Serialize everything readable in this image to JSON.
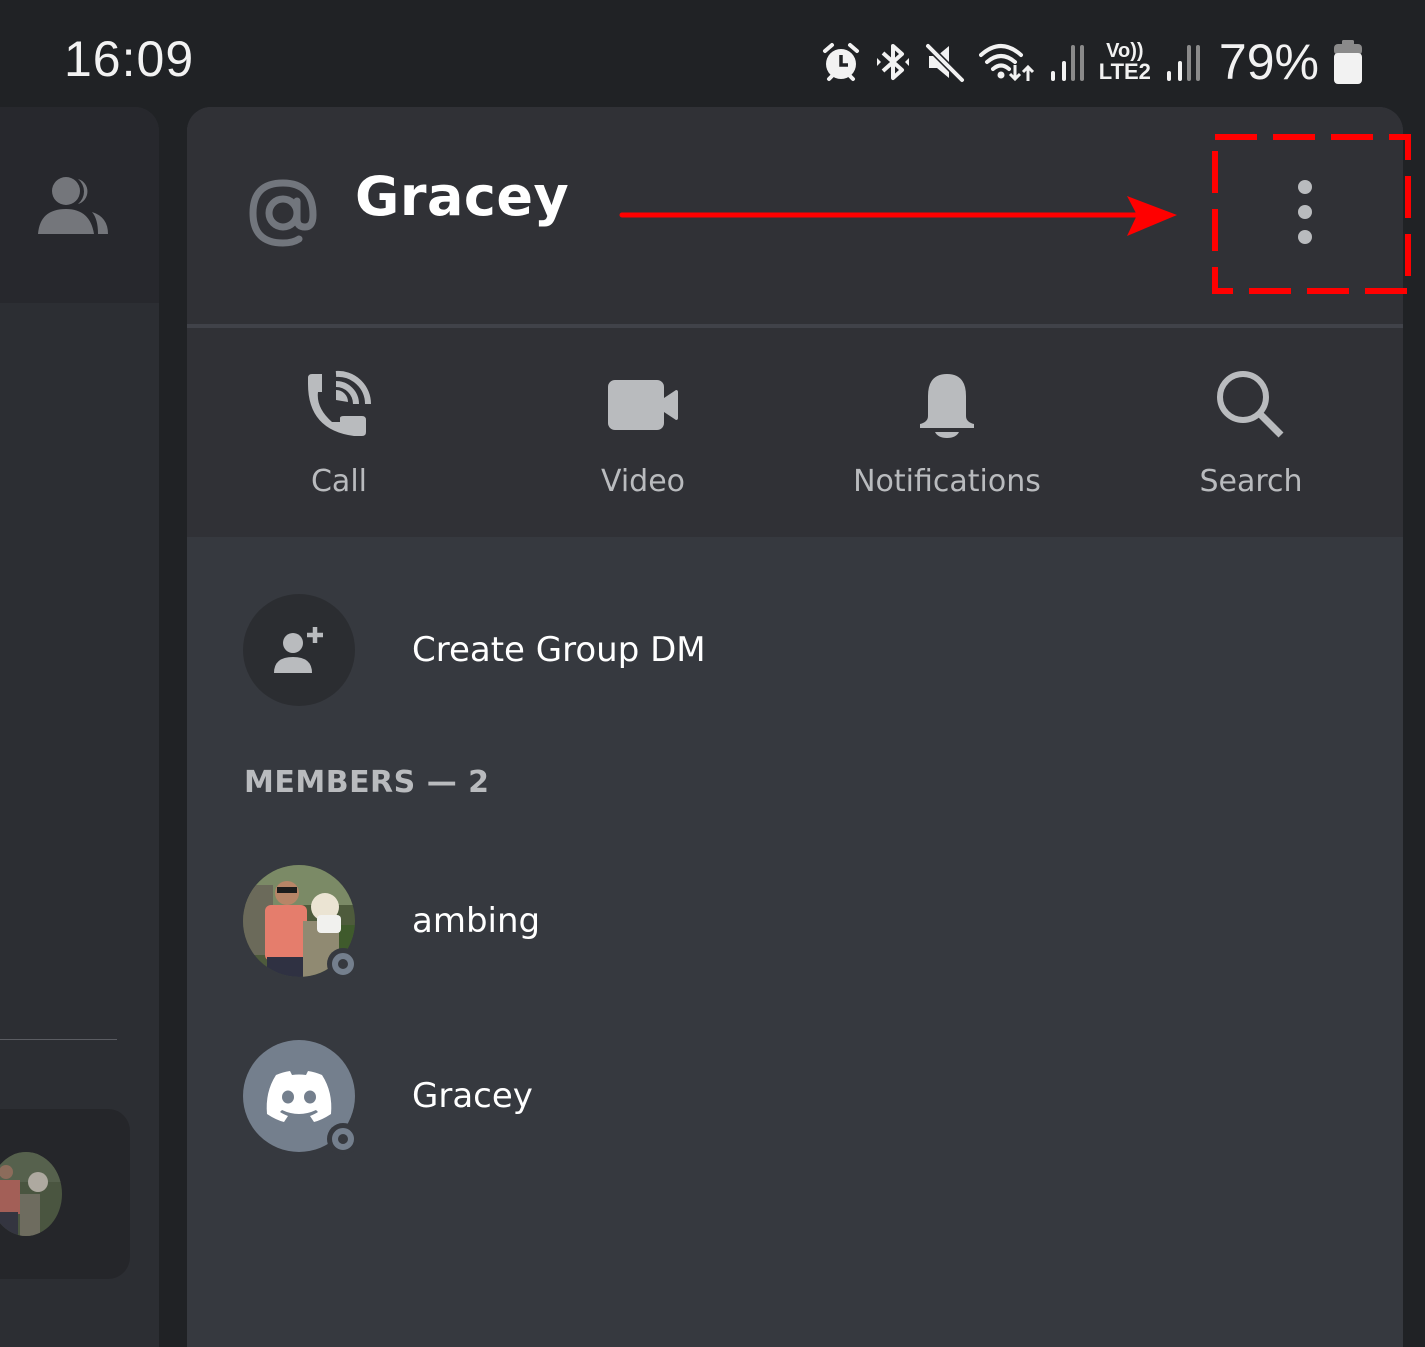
{
  "status_bar": {
    "time": "16:09",
    "icons": [
      "alarm-icon",
      "bluetooth-icon",
      "mute-icon",
      "wifi-icon",
      "signal-icon",
      "volte-icon",
      "signal-icon",
      "battery-icon"
    ],
    "volte_line1": "Vo))",
    "volte_line2": "LTE2",
    "battery_percent": "79%"
  },
  "left_panel": {
    "header_icon": "friends-icon"
  },
  "header": {
    "channel_icon": "at-icon",
    "title": "Gracey",
    "more_icon": "more-vertical-icon"
  },
  "actions": [
    {
      "label": "Call",
      "icon": "phone-call-icon"
    },
    {
      "label": "Video",
      "icon": "video-camera-icon"
    },
    {
      "label": "Notifications",
      "icon": "bell-icon"
    },
    {
      "label": "Search",
      "icon": "search-icon"
    }
  ],
  "create_group": {
    "label": "Create Group DM",
    "icon": "add-user-icon"
  },
  "members": {
    "header": "MEMBERS — 2",
    "list": [
      {
        "name": "ambing",
        "status": "offline",
        "avatar": "photo"
      },
      {
        "name": "Gracey",
        "status": "offline",
        "avatar": "discord-default"
      }
    ]
  },
  "annotation": {
    "color": "#ff0000",
    "type": "arrow-and-dashed-box",
    "target": "more-options-button"
  },
  "colors": {
    "background": "#202225",
    "panel_header": "#303136",
    "panel_body": "#36393f",
    "text_primary": "#ffffff",
    "text_muted": "#b9bbbe",
    "status_offline": "#747f8d"
  }
}
